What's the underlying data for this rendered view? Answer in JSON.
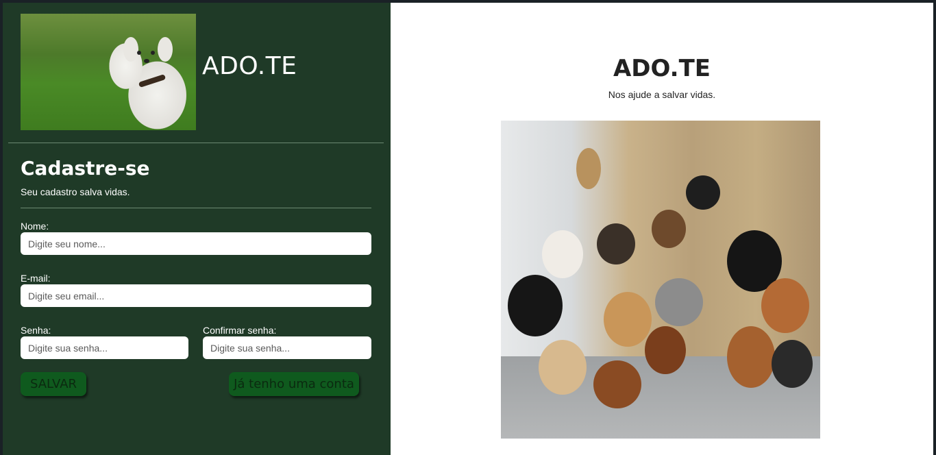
{
  "left_panel": {
    "brand": "ADO.TE",
    "register": {
      "title": "Cadastre-se",
      "subtitle": "Seu cadastro salva vidas.",
      "fields": {
        "name": {
          "label": "Nome:",
          "placeholder": "Digite seu nome..."
        },
        "email": {
          "label": "E-mail:",
          "placeholder": "Digite seu email..."
        },
        "password": {
          "label": "Senha:",
          "placeholder": "Digite sua senha..."
        },
        "confirm_password": {
          "label": "Confirmar senha:",
          "placeholder": "Digite sua senha..."
        }
      },
      "save_button": "SALVAR",
      "login_button": "Já tenho uma conta"
    }
  },
  "right_panel": {
    "title": "ADO.TE",
    "subtitle": "Nos ajude a salvar vidas."
  },
  "colors": {
    "panel_green": "#1f3a27",
    "button_green": "#0f5a1e",
    "button_text": "#0b2a10"
  }
}
